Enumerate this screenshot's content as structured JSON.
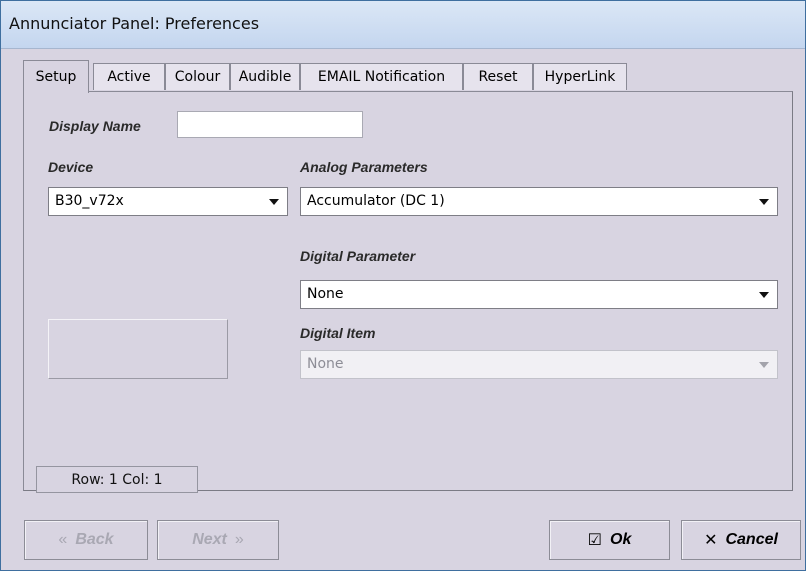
{
  "window": {
    "title": "Annunciator Panel: Preferences"
  },
  "tabs": [
    {
      "label": "Setup"
    },
    {
      "label": "Active"
    },
    {
      "label": "Colour"
    },
    {
      "label": "Audible"
    },
    {
      "label": "EMAIL Notification"
    },
    {
      "label": "Reset"
    },
    {
      "label": "HyperLink"
    }
  ],
  "setup": {
    "display_name_label": "Display Name",
    "display_name_value": "",
    "device_label": "Device",
    "device_value": "B30_v72x",
    "analog_label": "Analog Parameters",
    "analog_value": "Accumulator (DC 1)",
    "digital_param_label": "Digital Parameter",
    "digital_param_value": "None",
    "digital_item_label": "Digital Item",
    "digital_item_value": "None",
    "status": "Row: 1  Col: 1"
  },
  "buttons": {
    "back": "Back",
    "next": "Next",
    "ok": "Ok",
    "cancel": "Cancel"
  },
  "icons": {
    "back": "double-chevron-left-icon",
    "next": "double-chevron-right-icon",
    "ok": "checkbox-check-icon",
    "cancel": "x-icon"
  }
}
